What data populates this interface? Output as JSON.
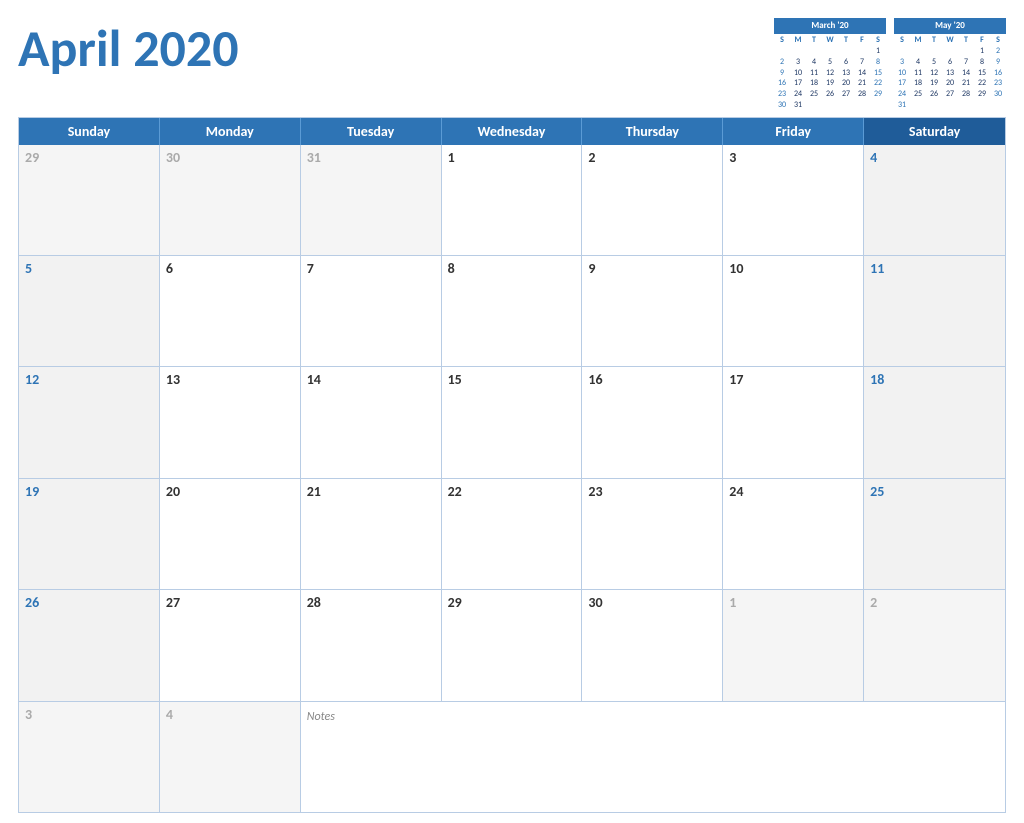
{
  "title": "April 2020",
  "header": {
    "dayNames": [
      "Sunday",
      "Monday",
      "Tuesday",
      "Wednesday",
      "Thursday",
      "Friday",
      "Saturday"
    ]
  },
  "miniCals": {
    "march": {
      "title": "March '20",
      "headers": [
        "S",
        "M",
        "T",
        "W",
        "T",
        "F",
        "S"
      ],
      "weeks": [
        [
          {
            "d": "1",
            "type": ""
          },
          {
            "d": "2",
            "type": ""
          },
          {
            "d": "3",
            "type": ""
          },
          {
            "d": "4",
            "type": ""
          },
          {
            "d": "5",
            "type": ""
          },
          {
            "d": "6",
            "type": ""
          },
          {
            "d": "7",
            "type": ""
          }
        ],
        [
          {
            "d": "8",
            "type": "sun"
          },
          {
            "d": "9",
            "type": ""
          },
          {
            "d": "10",
            "type": ""
          },
          {
            "d": "11",
            "type": ""
          },
          {
            "d": "12",
            "type": ""
          },
          {
            "d": "13",
            "type": ""
          },
          {
            "d": "14",
            "type": "sat"
          }
        ],
        [
          {
            "d": "15",
            "type": "sun"
          },
          {
            "d": "16",
            "type": ""
          },
          {
            "d": "17",
            "type": ""
          },
          {
            "d": "18",
            "type": ""
          },
          {
            "d": "19",
            "type": ""
          },
          {
            "d": "20",
            "type": ""
          },
          {
            "d": "21",
            "type": "sat"
          }
        ],
        [
          {
            "d": "22",
            "type": "sun"
          },
          {
            "d": "23",
            "type": ""
          },
          {
            "d": "24",
            "type": ""
          },
          {
            "d": "25",
            "type": ""
          },
          {
            "d": "26",
            "type": ""
          },
          {
            "d": "27",
            "type": ""
          },
          {
            "d": "28",
            "type": "sat"
          }
        ],
        [
          {
            "d": "29",
            "type": "sun"
          },
          {
            "d": "30",
            "type": ""
          },
          {
            "d": "31",
            "type": ""
          },
          {
            "d": "",
            "type": ""
          },
          {
            "d": "",
            "type": ""
          },
          {
            "d": "",
            "type": ""
          },
          {
            "d": "",
            "type": ""
          }
        ]
      ]
    },
    "may": {
      "title": "May '20",
      "headers": [
        "S",
        "M",
        "T",
        "W",
        "T",
        "F",
        "S"
      ],
      "weeks": [
        [
          {
            "d": "",
            "type": ""
          },
          {
            "d": "",
            "type": ""
          },
          {
            "d": "",
            "type": ""
          },
          {
            "d": "",
            "type": ""
          },
          {
            "d": "",
            "type": ""
          },
          {
            "d": "1",
            "type": ""
          },
          {
            "d": "2",
            "type": "sat"
          }
        ],
        [
          {
            "d": "3",
            "type": "sun"
          },
          {
            "d": "4",
            "type": ""
          },
          {
            "d": "5",
            "type": ""
          },
          {
            "d": "6",
            "type": ""
          },
          {
            "d": "7",
            "type": ""
          },
          {
            "d": "8",
            "type": ""
          },
          {
            "d": "9",
            "type": "sat"
          }
        ],
        [
          {
            "d": "10",
            "type": "sun"
          },
          {
            "d": "11",
            "type": ""
          },
          {
            "d": "12",
            "type": ""
          },
          {
            "d": "13",
            "type": ""
          },
          {
            "d": "14",
            "type": ""
          },
          {
            "d": "15",
            "type": ""
          },
          {
            "d": "16",
            "type": "sat"
          }
        ],
        [
          {
            "d": "17",
            "type": "sun"
          },
          {
            "d": "18",
            "type": ""
          },
          {
            "d": "19",
            "type": ""
          },
          {
            "d": "20",
            "type": ""
          },
          {
            "d": "21",
            "type": ""
          },
          {
            "d": "22",
            "type": ""
          },
          {
            "d": "23",
            "type": "sat"
          }
        ],
        [
          {
            "d": "24",
            "type": "sun"
          },
          {
            "d": "25",
            "type": ""
          },
          {
            "d": "26",
            "type": ""
          },
          {
            "d": "27",
            "type": ""
          },
          {
            "d": "28",
            "type": ""
          },
          {
            "d": "29",
            "type": ""
          },
          {
            "d": "30",
            "type": "sat"
          }
        ],
        [
          {
            "d": "31",
            "type": "sun"
          },
          {
            "d": "",
            "type": ""
          },
          {
            "d": "",
            "type": ""
          },
          {
            "d": "",
            "type": ""
          },
          {
            "d": "",
            "type": ""
          },
          {
            "d": "",
            "type": ""
          },
          {
            "d": "",
            "type": ""
          }
        ]
      ]
    }
  },
  "weeks": [
    [
      {
        "day": "29",
        "type": "prev"
      },
      {
        "day": "30",
        "type": "prev"
      },
      {
        "day": "31",
        "type": "prev"
      },
      {
        "day": "1",
        "type": "current"
      },
      {
        "day": "2",
        "type": "current"
      },
      {
        "day": "3",
        "type": "current"
      },
      {
        "day": "4",
        "type": "current-weekend"
      }
    ],
    [
      {
        "day": "5",
        "type": "current-sunday"
      },
      {
        "day": "6",
        "type": "current"
      },
      {
        "day": "7",
        "type": "current"
      },
      {
        "day": "8",
        "type": "current"
      },
      {
        "day": "9",
        "type": "current"
      },
      {
        "day": "10",
        "type": "current"
      },
      {
        "day": "11",
        "type": "current-weekend"
      }
    ],
    [
      {
        "day": "12",
        "type": "current-sunday"
      },
      {
        "day": "13",
        "type": "current"
      },
      {
        "day": "14",
        "type": "current"
      },
      {
        "day": "15",
        "type": "current"
      },
      {
        "day": "16",
        "type": "current"
      },
      {
        "day": "17",
        "type": "current"
      },
      {
        "day": "18",
        "type": "current-weekend"
      }
    ],
    [
      {
        "day": "19",
        "type": "current-sunday"
      },
      {
        "day": "20",
        "type": "current"
      },
      {
        "day": "21",
        "type": "current"
      },
      {
        "day": "22",
        "type": "current"
      },
      {
        "day": "23",
        "type": "current"
      },
      {
        "day": "24",
        "type": "current"
      },
      {
        "day": "25",
        "type": "current-weekend"
      }
    ],
    [
      {
        "day": "26",
        "type": "current-sunday"
      },
      {
        "day": "27",
        "type": "current"
      },
      {
        "day": "28",
        "type": "current"
      },
      {
        "day": "29",
        "type": "current"
      },
      {
        "day": "30",
        "type": "current"
      },
      {
        "day": "1",
        "type": "next"
      },
      {
        "day": "2",
        "type": "next-weekend"
      }
    ]
  ],
  "lastRow": {
    "cells": [
      {
        "day": "3",
        "type": "next"
      },
      {
        "day": "4",
        "type": "next"
      }
    ],
    "notesLabel": "Notes"
  }
}
